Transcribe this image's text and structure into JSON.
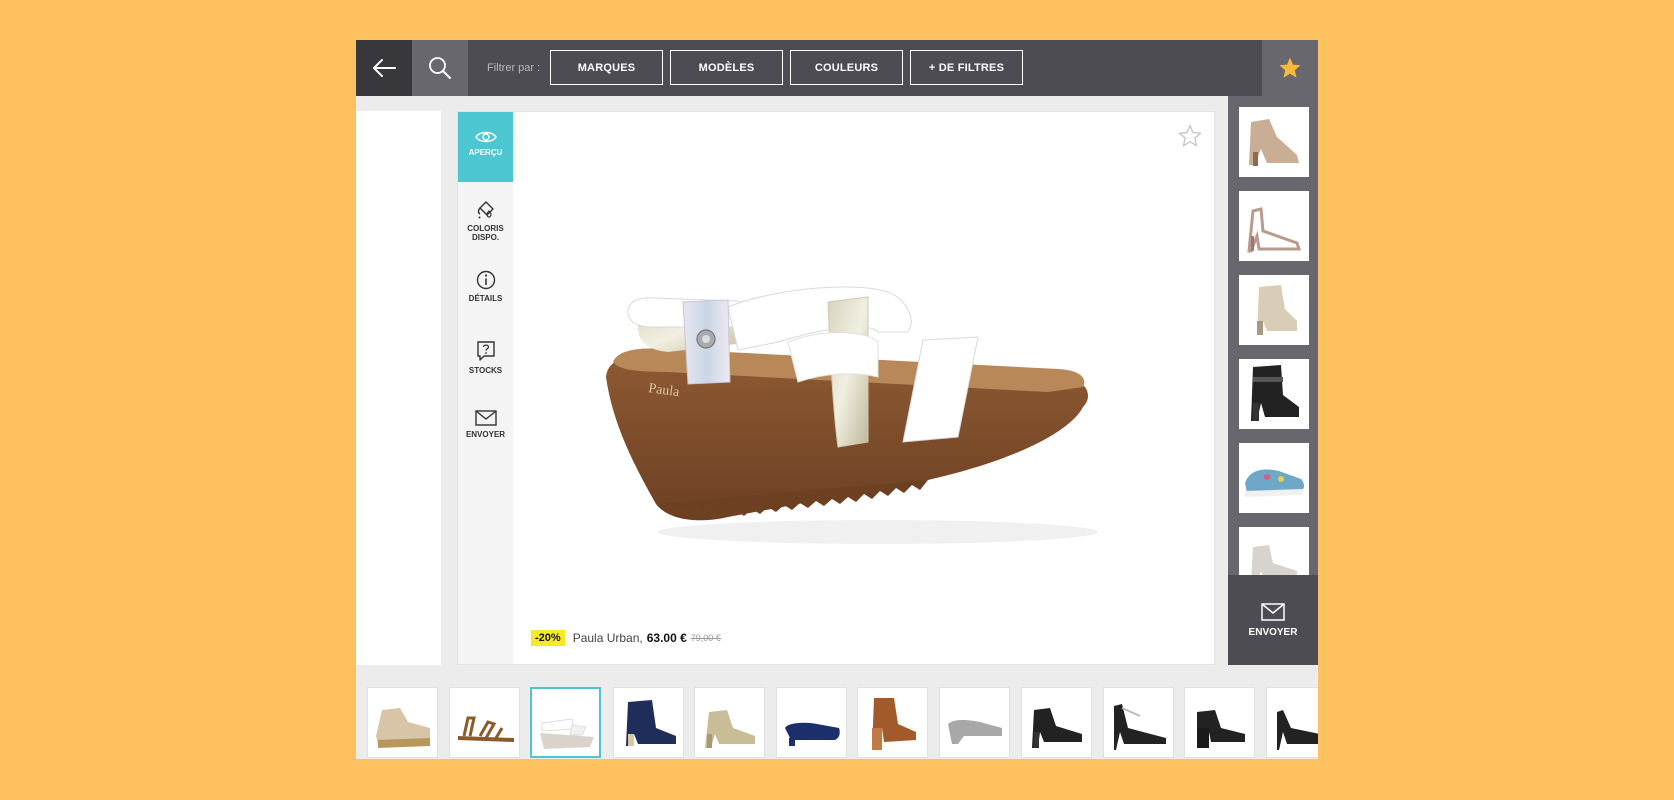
{
  "topbar": {
    "filter_label": "Filtrer par :",
    "filters": [
      "MARQUES",
      "MODÈLES",
      "COULEURS",
      "+ DE FILTRES"
    ]
  },
  "tabs": [
    {
      "label": "APERÇU",
      "icon": "eye-icon",
      "active": true
    },
    {
      "label": "COLORIS DISPO.",
      "icon": "paint-bucket-icon",
      "active": false
    },
    {
      "label": "DÉTAILS",
      "icon": "info-icon",
      "active": false
    },
    {
      "label": "STOCKS",
      "icon": "question-bubble-icon",
      "active": false
    },
    {
      "label": "ENVOYER",
      "icon": "envelope-icon",
      "active": false
    }
  ],
  "product": {
    "discount": "-20%",
    "brand": "Paula Urban,",
    "price": "63.00 €",
    "old_price": "79,00 €"
  },
  "sidebar": {
    "send_label": "ENVOYER"
  },
  "colors": {
    "accent": "#4cc7d2",
    "background": "#FDC15F",
    "dark_bar": "#4d4c52",
    "star": "#f6b93b",
    "discount": "#f5ea2a"
  }
}
